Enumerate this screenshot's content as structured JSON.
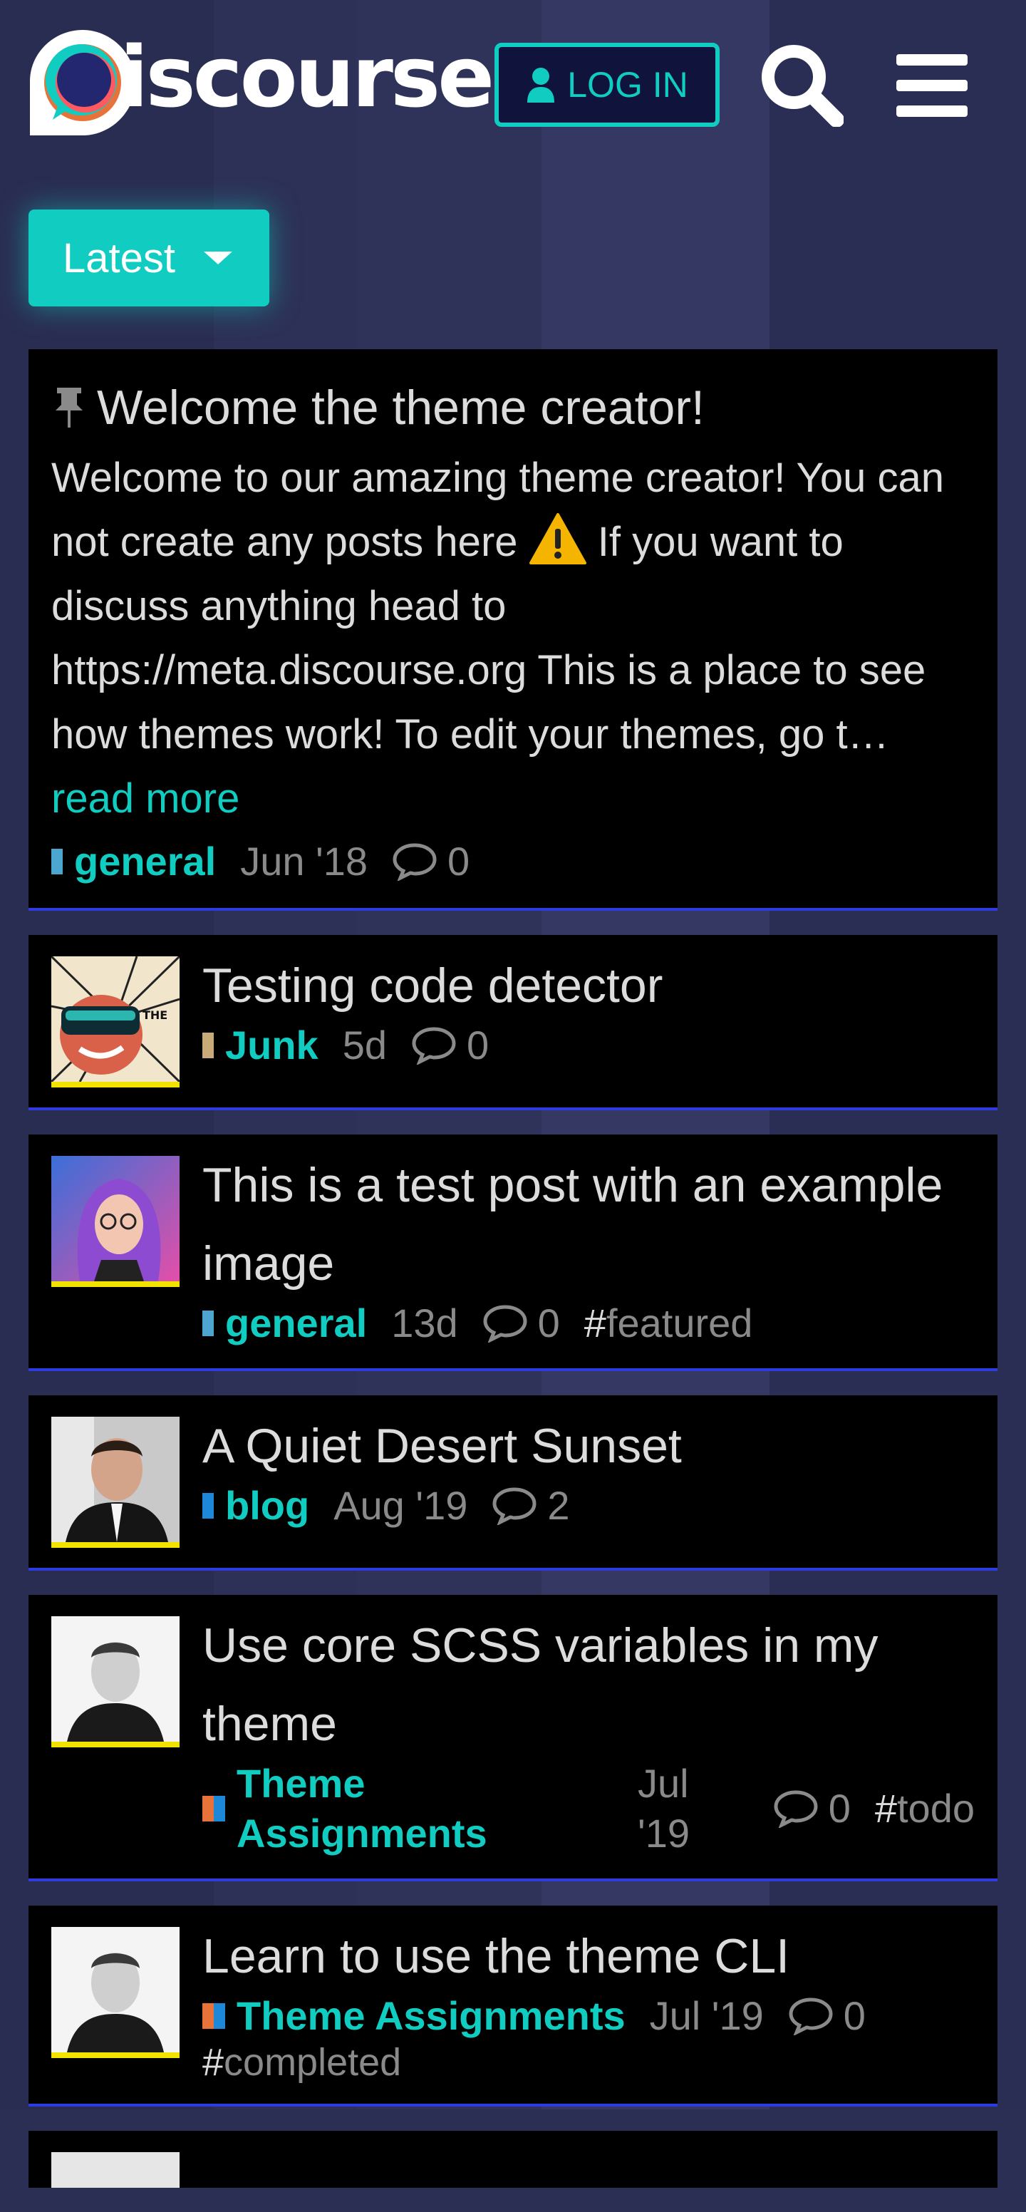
{
  "header": {
    "logo_text": "iscourse",
    "login_label": "LOG IN",
    "search_icon": "search-icon",
    "menu_icon": "hamburger-menu-icon"
  },
  "filter": {
    "label": "Latest"
  },
  "colors": {
    "accent": "#11ccc0",
    "background": "#2b2f54",
    "topic_bg": "#000000",
    "topic_border": "#2d3be0",
    "avatar_border": "#f2e200"
  },
  "pinned": {
    "title": "Welcome the theme creator!",
    "excerpt_part1": "Welcome to our amazing theme creator! You can not create any posts here",
    "excerpt_part2": " If you want to discuss anything head to https://meta.discourse.org This is a place to see how themes work! To edit your themes, go t…",
    "read_more": "read more",
    "category": "general",
    "category_color": "#4da6cf",
    "date": "Jun '18",
    "replies": "0"
  },
  "topics": [
    {
      "title": "Testing code detector",
      "category": "Junk",
      "category_colors": [
        "#c8ab78"
      ],
      "date": "5d",
      "replies": "0",
      "tags": []
    },
    {
      "title": "This is a test post with an example image",
      "category": "general",
      "category_colors": [
        "#4da6cf"
      ],
      "date": "13d",
      "replies": "0",
      "tags": [
        "featured"
      ]
    },
    {
      "title": "A Quiet Desert Sunset",
      "category": "blog",
      "category_colors": [
        "#1e88d8"
      ],
      "date": "Aug '19",
      "replies": "2",
      "tags": []
    },
    {
      "title": "Use core SCSS variables in my theme",
      "category": "Theme Assignments",
      "category_colors": [
        "#e8733a",
        "#1e88d8"
      ],
      "date": "Jul '19",
      "replies": "0",
      "tags": [
        "todo"
      ]
    },
    {
      "title": "Learn to use the theme CLI",
      "category": "Theme Assignments",
      "category_colors": [
        "#e8733a",
        "#1e88d8"
      ],
      "date": "Jul '19",
      "replies": "0",
      "tags": [
        "completed"
      ]
    }
  ]
}
